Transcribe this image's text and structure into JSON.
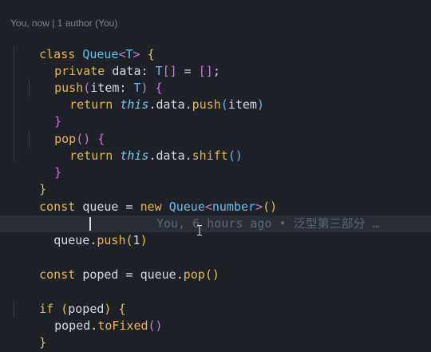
{
  "codelens": "You, now | 1 author (You)",
  "lines": {
    "l1": {
      "t1": "class ",
      "t2": "Queue",
      "t3": "<",
      "t4": "T",
      "t5": ">",
      "t6": " {"
    },
    "l2": {
      "t1": "private ",
      "t2": "data",
      "t3": ": ",
      "t4": "T",
      "t5": "[]",
      "t6": " = ",
      "t7": "[]",
      "t8": ";"
    },
    "l3": {
      "t1": "push",
      "t2": "(",
      "t3": "item",
      "t4": ": ",
      "t5": "T",
      "t6": ")",
      "t7": " {"
    },
    "l4": {
      "t1": "return ",
      "t2": "this",
      "t3": ".data.",
      "t4": "push",
      "t5": "(",
      "t6": "item",
      "t7": ")"
    },
    "l5": {
      "t1": "}"
    },
    "l6": {
      "t1": "pop",
      "t2": "()",
      "t3": " {"
    },
    "l7": {
      "t1": "return ",
      "t2": "this",
      "t3": ".data.",
      "t4": "shift",
      "t5": "()"
    },
    "l8": {
      "t1": "}"
    },
    "l9": {
      "t1": "}"
    },
    "l10": {
      "t1": "const ",
      "t2": "queue",
      "t3": " = ",
      "t4": "new ",
      "t5": "Queue",
      "t6": "<",
      "t7": "number",
      "t8": ">",
      "t9": "()"
    },
    "l12": {
      "t1": "queue",
      "t2": ".",
      "t3": "push",
      "t4": "(",
      "t5": "1",
      "t6": ")"
    },
    "l14": {
      "t1": "const ",
      "t2": "poped",
      "t3": " = ",
      "t4": "queue",
      "t5": ".",
      "t6": "pop",
      "t7": "()"
    },
    "l16": {
      "t1": "if ",
      "t2": "(",
      "t3": "poped",
      "t4": ")",
      "t5": " {"
    },
    "l17": {
      "t1": "poped",
      "t2": ".",
      "t3": "toFixed",
      "t4": "()"
    },
    "l18": {
      "t1": "}"
    }
  },
  "blame": "You, 6 hours ago • 泛型第三部分 …",
  "colors": {
    "background": "#1e2127",
    "current_line": "#2a2e36",
    "keyword": "#e8b94a",
    "type": "#61c2f0",
    "purple": "#c678dd"
  }
}
